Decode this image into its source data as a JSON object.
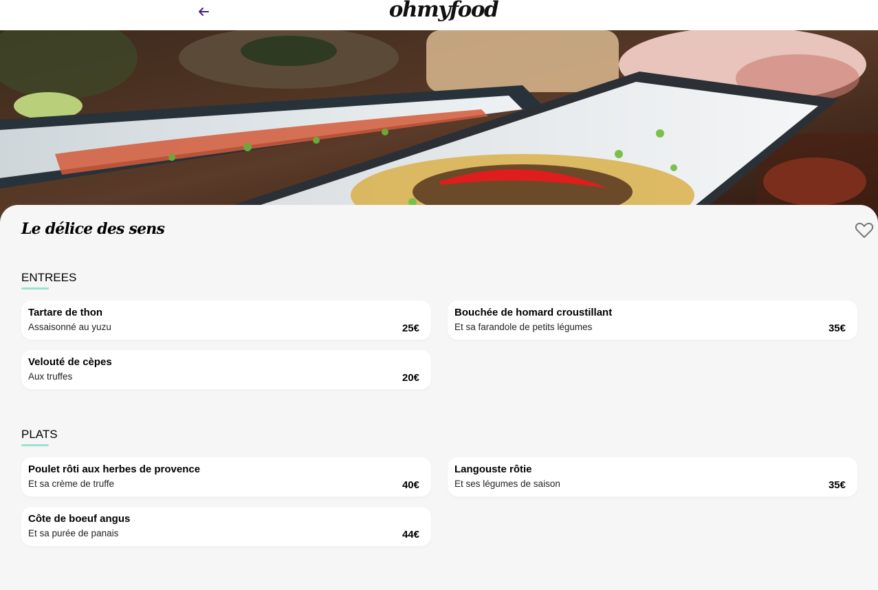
{
  "header": {
    "logo": "ohmyfood",
    "back_icon": "arrow-left-icon"
  },
  "hero": {
    "image": "asian-dishes-on-ceramic-plates-photo"
  },
  "restaurant": {
    "name": "Le délice des sens",
    "favorite_icon": "heart-outline-icon"
  },
  "colors": {
    "accent": "#99e2d0",
    "back_arrow": "#4a1d7a",
    "background": "#f6f6f6"
  },
  "sections": [
    {
      "title": "ENTREES",
      "items": [
        {
          "name": "Tartare de thon",
          "description": "Assaisonné au yuzu",
          "price": "25€"
        },
        {
          "name": "Bouchée de homard croustillant",
          "description": "Et sa farandole de petits légumes",
          "price": "35€"
        },
        {
          "name": "Velouté de cèpes",
          "description": "Aux truffes",
          "price": "20€"
        }
      ]
    },
    {
      "title": "PLATS",
      "items": [
        {
          "name": "Poulet rôti aux herbes de provence",
          "description": "Et sa crème de truffe",
          "price": "40€"
        },
        {
          "name": "Langouste rôtie",
          "description": "Et ses légumes de saison",
          "price": "35€"
        },
        {
          "name": "Côte de boeuf angus",
          "description": "Et sa purée de panais",
          "price": "44€"
        }
      ]
    }
  ]
}
